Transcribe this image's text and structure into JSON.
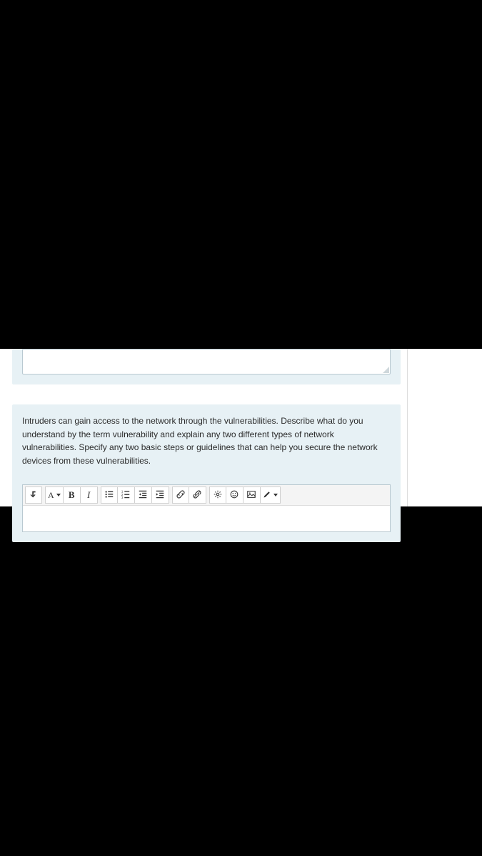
{
  "question": {
    "prompt": "Intruders can gain access to the network through the vulnerabilities. Describe what do you understand by the term vulnerability and explain any two different types of network vulnerabilities. Specify any two basic steps or guidelines that can help you secure the network devices from these vulnerabilities."
  },
  "toolbar": {
    "toggle": "↴",
    "font_label": "A",
    "bold": "B",
    "italic": "I"
  }
}
